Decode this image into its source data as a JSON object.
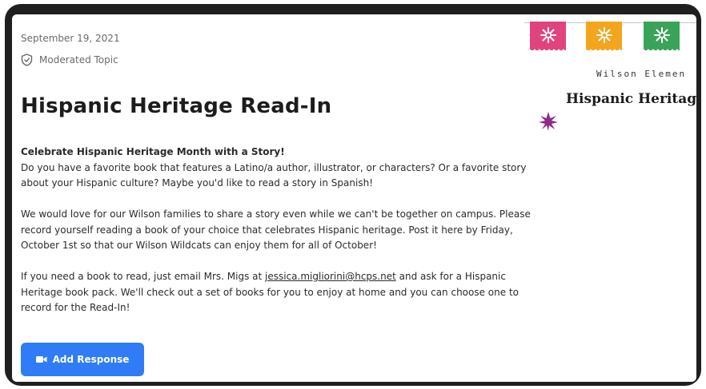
{
  "post": {
    "date": "September 19, 2021",
    "moderated_label": "Moderated Topic",
    "title": "Hispanic Heritage Read-In",
    "lead": "Celebrate Hispanic Heritage Month with a Story!",
    "p1": "Do you have a favorite book that features a Latino/a author, illustrator, or characters? Or a favorite story about your Hispanic culture? Maybe you'd like to read a story in Spanish!",
    "p2": "We would love for our Wilson families to share a story even while we can't be together on campus. Please record yourself reading a book of your choice that celebrates Hispanic heritage. Post it here by Friday, October 1st so that our Wilson Wildcats can enjoy them for all of October!",
    "p3_before": "If you need a book to read, just email Mrs. Migs at ",
    "p3_email": "jessica.migliorini@hcps.net",
    "p3_after": " and ask for a Hispanic Heritage book pack. We'll check out a set of books for you to enjoy at home and you can choose one to record for the Read-In!",
    "add_response_label": "Add Response"
  },
  "banner": {
    "school_text": "Wilson Elemen",
    "heritage_text": "Hispanic Heritage"
  },
  "colors": {
    "accent": "#2f7cf6",
    "flag_pink": "#e0447e",
    "flag_orange": "#f3a51d",
    "flag_green": "#3aa35a",
    "star": "#8e2a8a"
  },
  "icons": {
    "moderated": "shield-check-icon",
    "button": "video-camera-icon",
    "flag": "papel-picado-flag",
    "decoration": "star-burst"
  }
}
